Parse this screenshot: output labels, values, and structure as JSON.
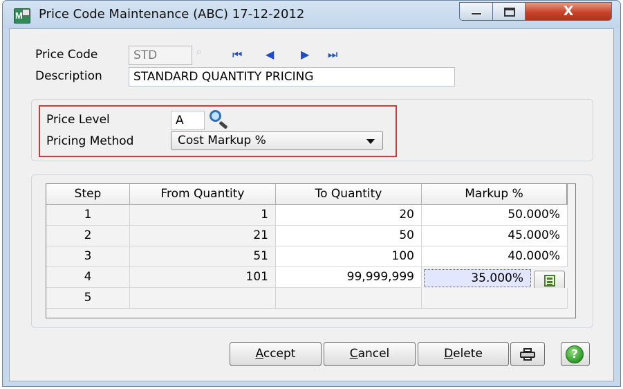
{
  "window": {
    "title": "Price Code Maintenance (ABC) 17-12-2012",
    "close_glyph": "X"
  },
  "header": {
    "price_code_label": "Price Code",
    "price_code_value": "STD",
    "description_label": "Description",
    "description_value": "STANDARD QUANTITY PRICING"
  },
  "pricing": {
    "price_level_label": "Price Level",
    "price_level_value": "A",
    "pricing_method_label": "Pricing Method",
    "pricing_method_value": "Cost Markup %"
  },
  "grid": {
    "columns": [
      "Step",
      "From Quantity",
      "To Quantity",
      "Markup %"
    ],
    "rows": [
      {
        "step": "1",
        "from": "1",
        "to": "20",
        "markup": "50.000%"
      },
      {
        "step": "2",
        "from": "21",
        "to": "50",
        "markup": "45.000%"
      },
      {
        "step": "3",
        "from": "51",
        "to": "100",
        "markup": "40.000%"
      },
      {
        "step": "4",
        "from": "101",
        "to": "99,999,999",
        "markup": "35.000%"
      },
      {
        "step": "5",
        "from": "",
        "to": "",
        "markup": ""
      }
    ]
  },
  "buttons": {
    "accept_hotkey": "A",
    "accept_rest": "ccept",
    "cancel_hotkey": "C",
    "cancel_rest": "ancel",
    "delete_hotkey": "D",
    "delete_rest": "elete",
    "help_glyph": "?"
  },
  "colors": {
    "highlight_box": "#d23a3a",
    "nav_arrows": "#1e4cc8",
    "selected_cell": "#e3e6ff"
  },
  "icons": {
    "app": "app-icon",
    "lookup": "magnifier-icon",
    "print": "printer-icon",
    "help": "help-icon",
    "calculator": "calculator-icon"
  }
}
